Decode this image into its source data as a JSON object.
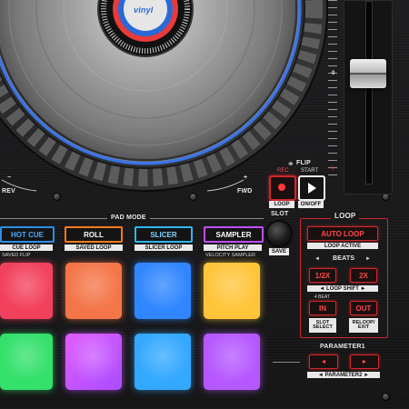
{
  "jog": {
    "logo_text": "vinyl",
    "rev_label": "REV",
    "fwd_label": "FWD",
    "rev_sign": "−",
    "fwd_sign": "+"
  },
  "tempo": {
    "zero_label": "0",
    "plus_label": "+",
    "minus_label": "−"
  },
  "flip": {
    "title": "FLIP",
    "rec_label": "REC",
    "start_label": "START",
    "loop_label": "LOOP",
    "onoff_label": "ON/OFF"
  },
  "slot": {
    "title": "SLOT",
    "save_label": "SAVE"
  },
  "pad_mode": {
    "title": "PAD MODE",
    "buttons": [
      {
        "label": "HOT CUE",
        "color": "#2b8fe8",
        "shift": "CUE LOOP",
        "sub": "SAVED FLIP"
      },
      {
        "label": "ROLL",
        "color": "#ff7a1a",
        "shift": "SAVED LOOP",
        "sub": ""
      },
      {
        "label": "SLICER",
        "color": "#2fb6f0",
        "shift": "SLICER LOOP",
        "sub": ""
      },
      {
        "label": "SAMPLER",
        "color": "#c04cff",
        "shift": "PITCH PLAY",
        "sub": "VELOCITY SAMPLER"
      }
    ]
  },
  "pads": {
    "row1": [
      {
        "color": "#f2415c"
      },
      {
        "color": "#f47548"
      },
      {
        "color": "#2f86ff"
      },
      {
        "color": "#ffc53a"
      }
    ],
    "row2": [
      {
        "color": "#32e06a"
      },
      {
        "color": "#c454ff"
      },
      {
        "color": "#33a8ff"
      },
      {
        "color": "#b658ff"
      }
    ]
  },
  "loop": {
    "title": "LOOP",
    "auto_loop": "AUTO LOOP",
    "loop_active": "LOOP ACTIVE",
    "beats_label": "BEATS",
    "left_arrow": "◄",
    "right_arrow": "►",
    "half": "1/2X",
    "double": "2X",
    "loop_shift": "LOOP SHIFT",
    "four_beat": "4 BEAT",
    "in_label": "IN",
    "out_label": "OUT",
    "slot_select": "SLOT\nSELECT",
    "reloop_exit": "RELOOP/\nEXIT"
  },
  "parameter": {
    "title": "PARAMETER1",
    "left": "◄",
    "right": "►",
    "param2": "PARAMETER2"
  }
}
